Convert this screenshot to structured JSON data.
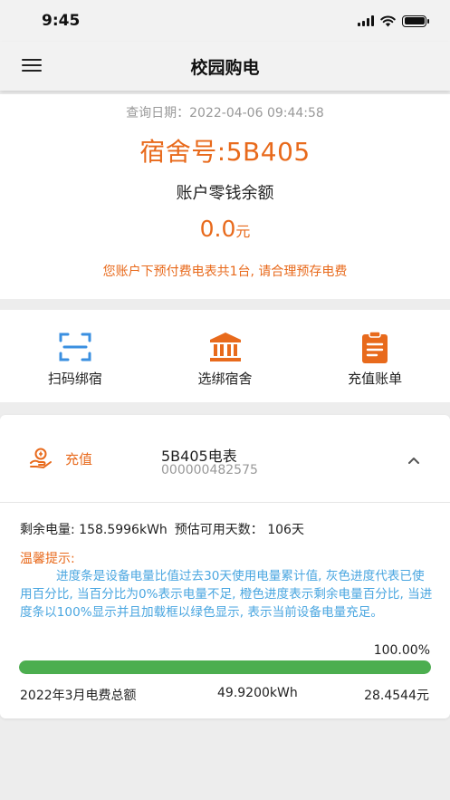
{
  "status_bar": {
    "time": "9:45"
  },
  "nav": {
    "title": "校园购电"
  },
  "summary": {
    "query_date": "查询日期：2022-04-06 09:44:58",
    "dorm": "宿舍号:5B405",
    "balance_label": "账户零钱余额",
    "balance_value": "0.0",
    "balance_unit": "元",
    "notice": "您账户下预付费电表共1台, 请合理预存电费"
  },
  "actions": [
    {
      "label": "扫码绑宿",
      "icon": "scan-icon"
    },
    {
      "label": "选绑宿舍",
      "icon": "building-icon"
    },
    {
      "label": "充值账单",
      "icon": "bill-icon"
    }
  ],
  "meter": {
    "recharge_label": "充值",
    "name": "5B405电表",
    "number": "000000482575",
    "usage_remaining": "剩余电量: 158.5996kWh",
    "usage_days": "预估可用天数： 106天",
    "tips_title": "温馨提示:",
    "tips_body": "进度条是设备电量比值过去30天使用电量累计值, 灰色进度代表已使用百分比, 当百分比为0%表示电量不足, 橙色进度表示剩余电量百分比, 当进度条以100%显示并且加载框以绿色显示, 表示当前设备电量充足。",
    "progress_label": "100.00%",
    "progress_fraction": 1.0,
    "bill_month": "2022年3月电费总额",
    "bill_kwh": "49.9200kWh",
    "bill_amount": "28.4544元"
  },
  "colors": {
    "accent_orange": "#e86a1c",
    "tip_blue": "#4aa6e0",
    "progress_green": "#4cae4f",
    "scan_blue": "#3a8fe0"
  }
}
